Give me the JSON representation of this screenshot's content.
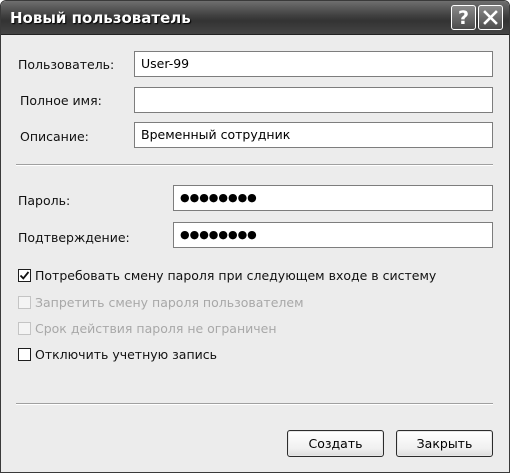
{
  "window": {
    "title": "Новый пользователь",
    "help_glyph": "?"
  },
  "form": {
    "user_label": "Пользователь:",
    "user_value": "User-99",
    "fullname_label": "Полное имя:",
    "fullname_value": "",
    "description_label": "Описание:",
    "description_value": "Временный сотрудник",
    "password_label": "Пароль:",
    "password_value": "●●●●●●●●",
    "confirm_label": "Подтверждение:",
    "confirm_value": "●●●●●●●●"
  },
  "options": [
    {
      "label": "Потребовать смену пароля при следующем входе в систему",
      "checked": true,
      "enabled": true
    },
    {
      "label": "Запретить смену пароля пользователем",
      "checked": false,
      "enabled": false
    },
    {
      "label": "Срок действия пароля не ограничен",
      "checked": false,
      "enabled": false
    },
    {
      "label": "Отключить учетную запись",
      "checked": false,
      "enabled": true
    }
  ],
  "buttons": {
    "create": "Создать",
    "close": "Закрыть"
  },
  "icons": {
    "help": "help-icon",
    "close": "close-icon",
    "check": "checkmark-icon"
  }
}
